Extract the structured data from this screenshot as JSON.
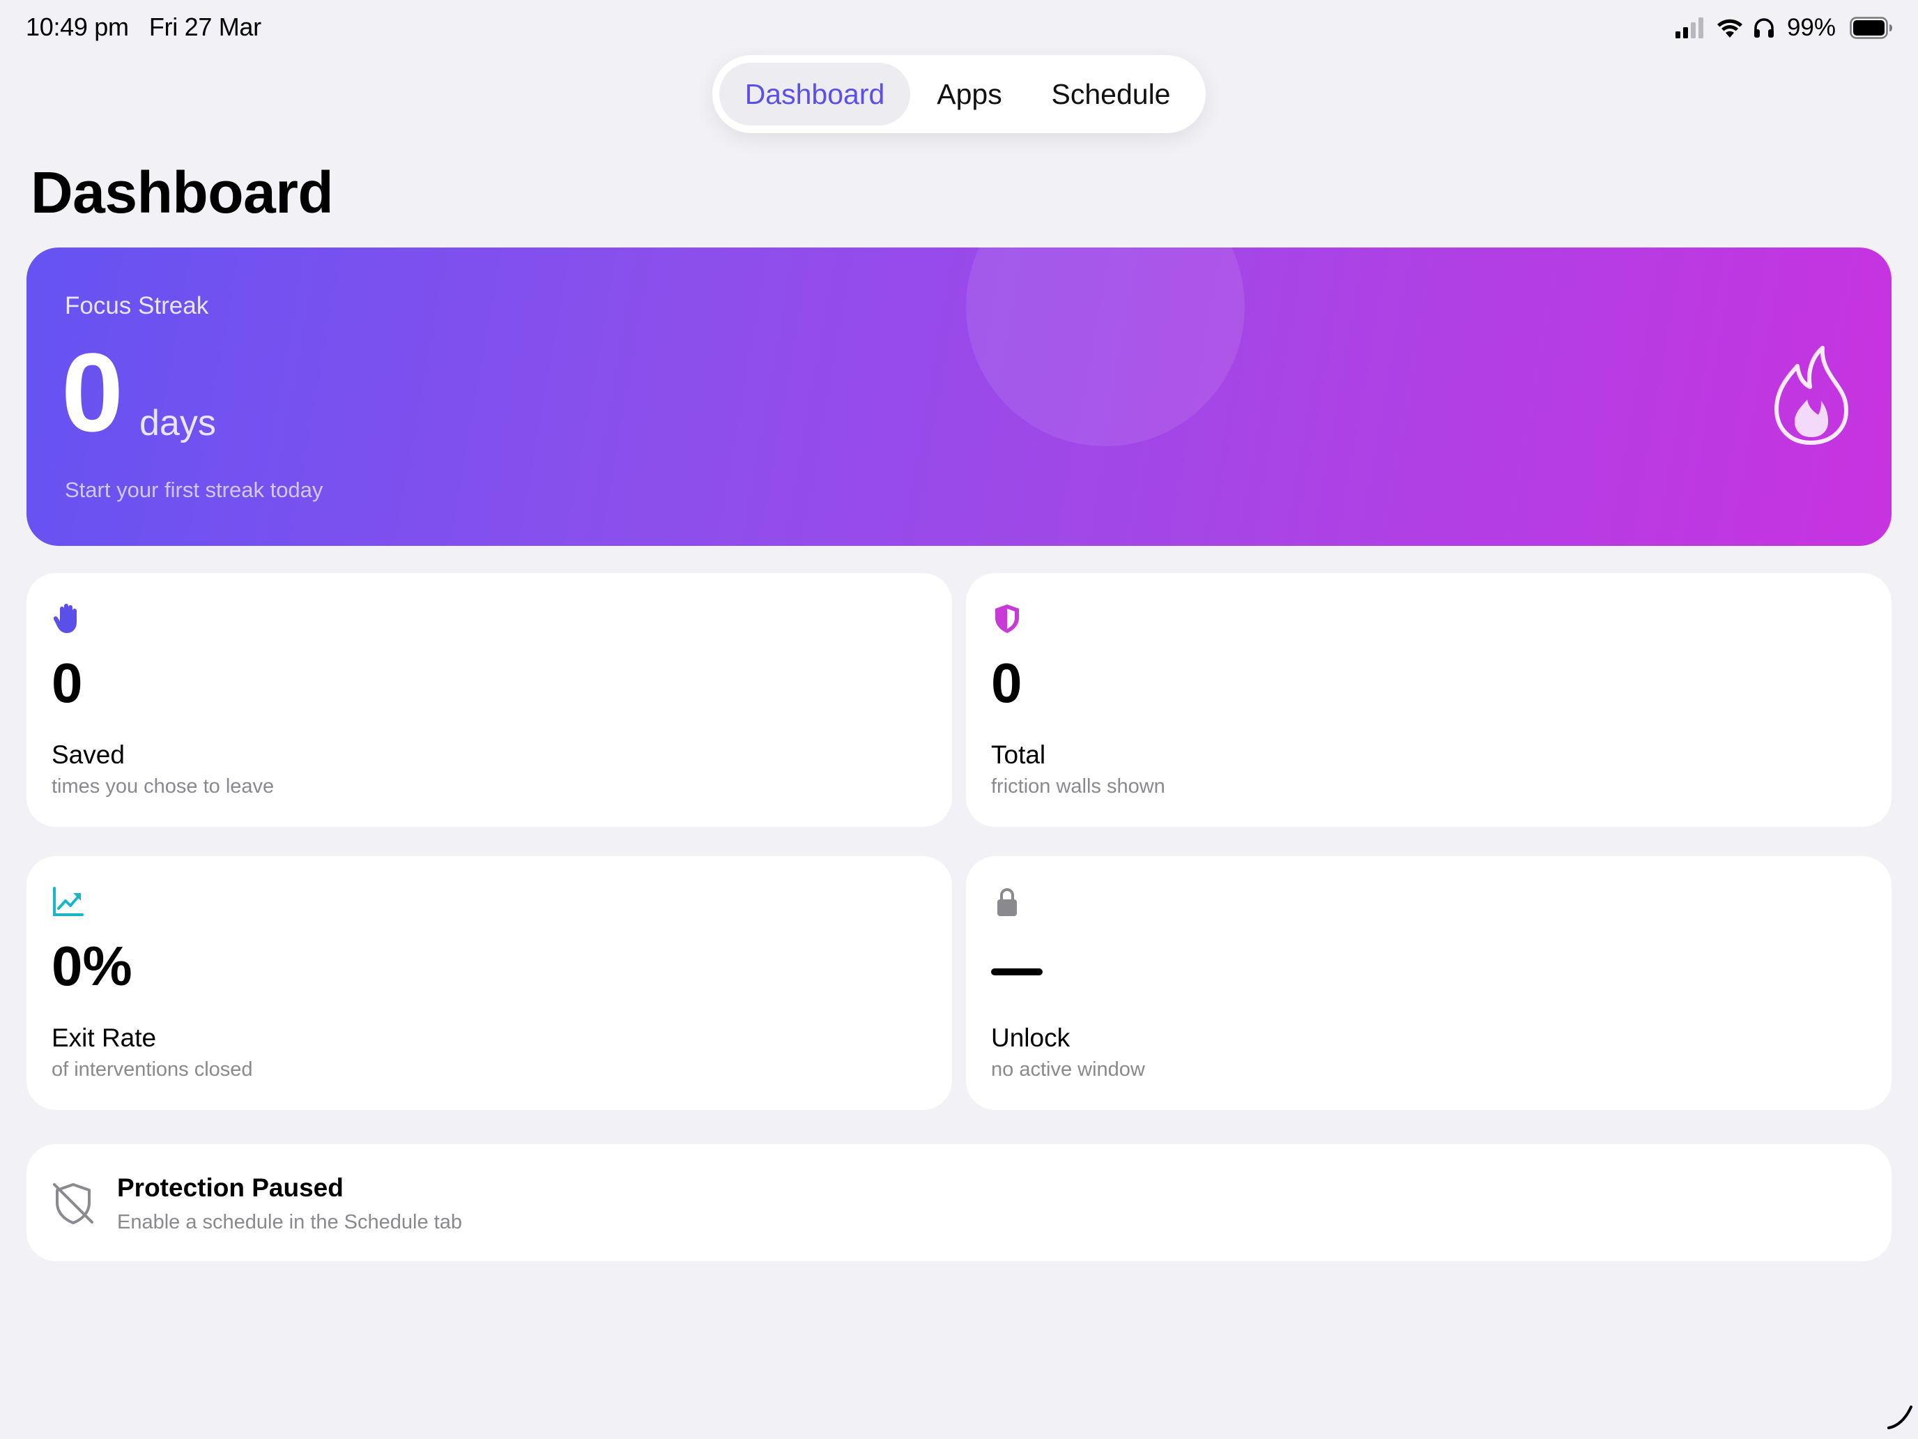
{
  "status_bar": {
    "time": "10:49 pm",
    "date": "Fri 27 Mar",
    "battery_percent": "99%",
    "icons": [
      "cellular-signal-icon",
      "wifi-icon",
      "headphones-icon",
      "battery-icon"
    ]
  },
  "tabs": [
    {
      "label": "Dashboard",
      "active": true
    },
    {
      "label": "Apps",
      "active": false
    },
    {
      "label": "Schedule",
      "active": false
    }
  ],
  "page": {
    "title": "Dashboard"
  },
  "streak": {
    "label": "Focus Streak",
    "value": "0",
    "unit": "days",
    "subtitle": "Start your first streak today",
    "icon": "flame-icon"
  },
  "stats": {
    "saved": {
      "value": "0",
      "title": "Saved",
      "subtitle": "times you chose to leave",
      "icon": "hand-raised-icon",
      "color": "#5b4fe9"
    },
    "total": {
      "value": "0",
      "title": "Total",
      "subtitle": "friction walls shown",
      "icon": "shield-half-icon",
      "color": "#c83ad6"
    },
    "exit_rate": {
      "value": "0%",
      "title": "Exit Rate",
      "subtitle": "of interventions closed",
      "icon": "chart-trend-up-icon",
      "color": "#17b7c9"
    },
    "unlock": {
      "value": "—",
      "title": "Unlock",
      "subtitle": "no active window",
      "icon": "lock-icon",
      "color": "#8a8a8e"
    }
  },
  "protection": {
    "title": "Protection Paused",
    "subtitle": "Enable a schedule in the Schedule tab",
    "icon": "shield-slash-icon"
  },
  "colors": {
    "background": "#f2f1f6",
    "accent": "#5b4fe9",
    "gradient_start": "#6553f2",
    "gradient_end": "#c733e0",
    "secondary_text": "#8a8a8e"
  }
}
